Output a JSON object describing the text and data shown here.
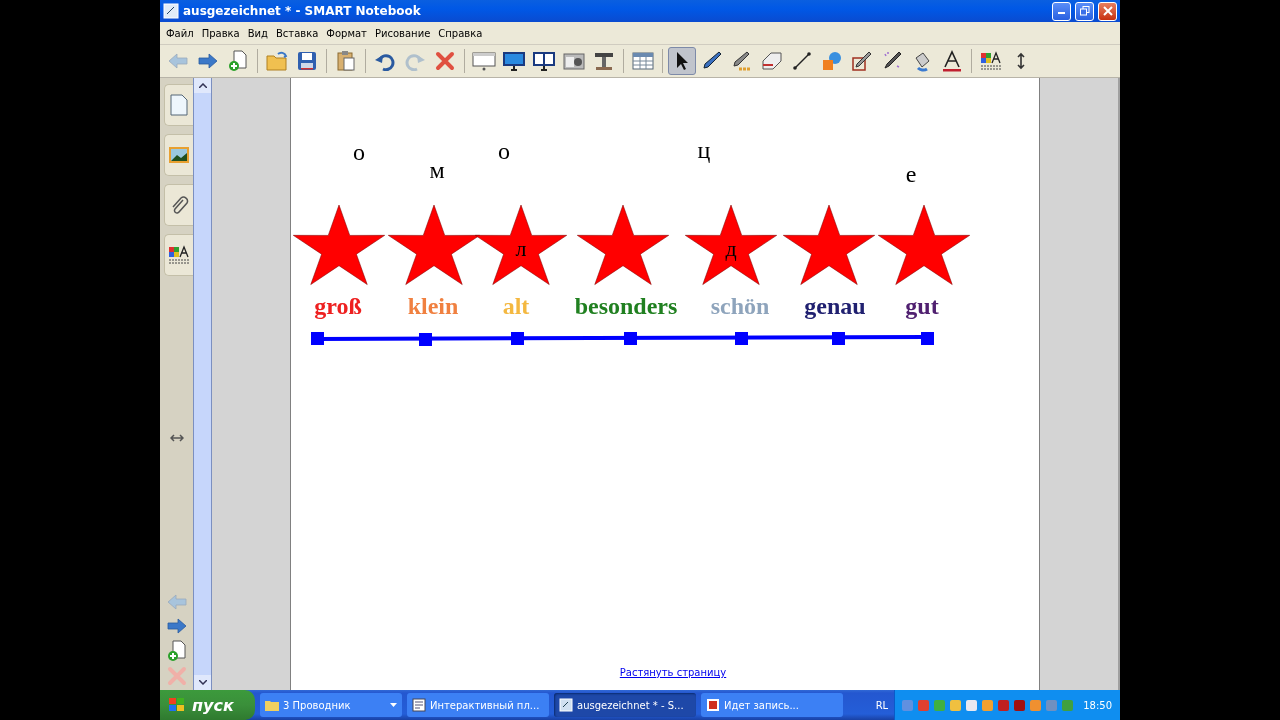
{
  "window": {
    "title": "ausgezeichnet * - SMART Notebook"
  },
  "menu": [
    "Файл",
    "Правка",
    "Вид",
    "Вставка",
    "Формат",
    "Рисование",
    "Справка"
  ],
  "toolbar": [
    [
      {
        "kind": "back",
        "selected": false
      },
      {
        "kind": "forward",
        "selected": false
      },
      {
        "kind": "add-page",
        "selected": false
      }
    ],
    [
      {
        "kind": "open",
        "selected": false
      },
      {
        "kind": "save",
        "selected": false
      }
    ],
    [
      {
        "kind": "paste",
        "selected": false
      }
    ],
    [
      {
        "kind": "undo",
        "selected": false
      },
      {
        "kind": "redo",
        "selected": false
      },
      {
        "kind": "delete",
        "selected": false
      }
    ],
    [
      {
        "kind": "shade",
        "selected": false
      },
      {
        "kind": "monitor",
        "selected": false
      },
      {
        "kind": "dual",
        "selected": false
      },
      {
        "kind": "camera",
        "selected": false
      },
      {
        "kind": "doccam",
        "selected": false
      }
    ],
    [
      {
        "kind": "table",
        "selected": false
      }
    ],
    [
      {
        "kind": "select",
        "selected": true
      },
      {
        "kind": "pen",
        "selected": false
      },
      {
        "kind": "creative",
        "selected": false
      },
      {
        "kind": "eraser",
        "selected": false
      },
      {
        "kind": "line",
        "selected": false
      },
      {
        "kind": "shapes",
        "selected": false
      },
      {
        "kind": "recognition",
        "selected": false
      },
      {
        "kind": "magic",
        "selected": false
      },
      {
        "kind": "fill",
        "selected": false
      },
      {
        "kind": "text",
        "selected": false
      }
    ],
    [
      {
        "kind": "properties",
        "selected": false
      },
      {
        "kind": "move",
        "selected": false
      }
    ]
  ],
  "sidebar": {
    "tabs": [
      {
        "kind": "pages",
        "selected": false
      },
      {
        "kind": "gallery",
        "selected": false
      },
      {
        "kind": "attachments",
        "selected": false
      },
      {
        "kind": "properties",
        "selected": false
      }
    ],
    "bottom": [
      {
        "kind": "back"
      },
      {
        "kind": "forward"
      },
      {
        "kind": "add-page"
      },
      {
        "kind": "delete"
      }
    ]
  },
  "canvas": {
    "letters": [
      {
        "text": "о"
      },
      {
        "text": "м"
      },
      {
        "text": "о"
      },
      {
        "text": "ц"
      },
      {
        "text": "е"
      }
    ],
    "stars": [
      {
        "kind": "plain"
      },
      {
        "kind": "plain"
      },
      {
        "kind": "lettered",
        "letter": "л"
      },
      {
        "kind": "plain"
      },
      {
        "kind": "lettered",
        "letter": "д"
      },
      {
        "kind": "plain"
      },
      {
        "kind": "plain"
      }
    ],
    "words": [
      {
        "text": "groß",
        "color": "#ee2020"
      },
      {
        "text": "klein",
        "color": "#f08040"
      },
      {
        "text": "alt",
        "color": "#f4b840"
      },
      {
        "text": "besonders",
        "color": "#208020"
      },
      {
        "text": "schön",
        "color": "#8ea4bc"
      },
      {
        "text": "genau",
        "color": "#202070"
      },
      {
        "text": "gut",
        "color": "#502070"
      }
    ],
    "link": "Растянуть страницу"
  },
  "taskbar": {
    "start": "пуск",
    "tasks": [
      {
        "label": "3 Проводник",
        "kind": "group",
        "selected": false
      },
      {
        "label": "Интерактивный пл...",
        "kind": "doc",
        "selected": false
      },
      {
        "label": "ausgezeichnet * - S...",
        "kind": "notebook",
        "selected": true
      },
      {
        "label": "Идет запись...",
        "kind": "recorder",
        "selected": false
      }
    ],
    "language": "RL",
    "clock": "18:50"
  }
}
